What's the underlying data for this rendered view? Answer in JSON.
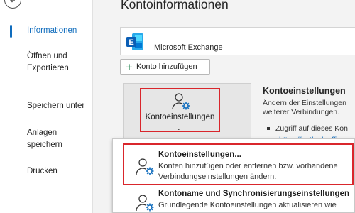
{
  "sidebar": {
    "items": [
      {
        "label": "Informationen"
      },
      {
        "label": "Öffnen und"
      },
      {
        "label": "Exportieren"
      },
      {
        "label": "Speichern unter"
      },
      {
        "label": "Anlagen"
      },
      {
        "label": "speichern"
      },
      {
        "label": "Drucken"
      }
    ]
  },
  "page": {
    "title": "Kontoinformationen"
  },
  "account": {
    "name": "Microsoft Exchange",
    "logo_icon": "exchange-logo"
  },
  "add_account": {
    "label": "Konto hinzufügen",
    "icon": "plus-icon"
  },
  "account_settings_button": {
    "label": "Kontoeinstellungen",
    "icon": "account-settings-icon"
  },
  "section": {
    "title": "Kontoeinstellungen ",
    "desc_line1": "Ändern der Einstellungen ",
    "desc_line2": "weiterer Verbindungen.",
    "bullet": "Zugriff auf dieses Kon",
    "link": "https://outlook.offic"
  },
  "dropdown": {
    "items": [
      {
        "title": "Kontoeinstellungen...",
        "desc_line1": "Konten hinzufügen oder entfernen bzw. vorhandene",
        "desc_line2": "Verbindungseinstellungen ändern."
      },
      {
        "title": "Kontoname und Synchronisierungseinstellungen",
        "desc_line1": "Grundlegende Kontoeinstellungen aktualisieren wie"
      }
    ]
  },
  "colors": {
    "accent": "#0f6cbd",
    "highlight_border": "#d9262c",
    "exchange_blue": "#0a5eb5"
  }
}
